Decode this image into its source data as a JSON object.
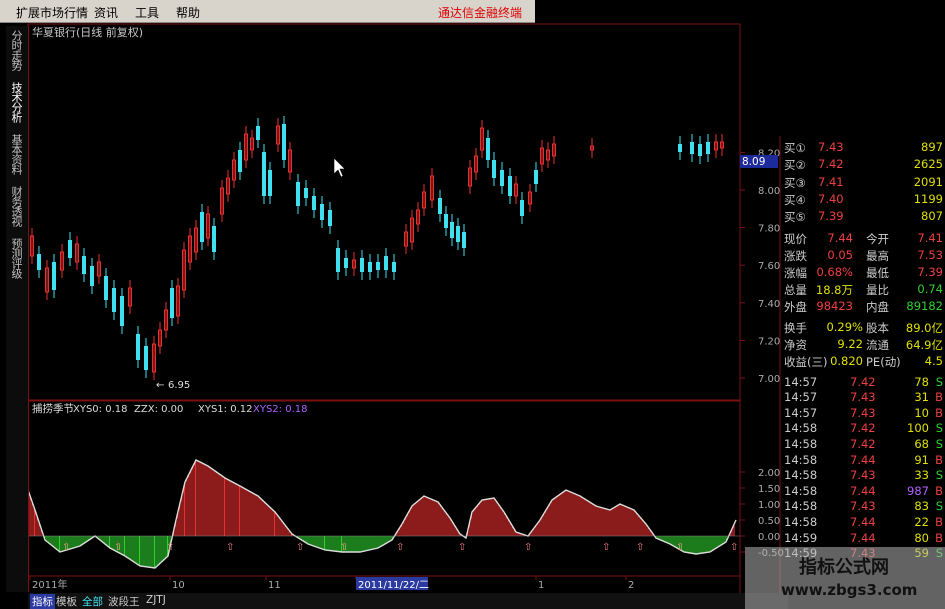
{
  "menu": {
    "items": [
      "扩展市场行情",
      "资讯",
      "工具",
      "帮助"
    ],
    "brand": "通达信金融终端"
  },
  "side_tabs": [
    "分时走势",
    "技术分析",
    "基本资料",
    "财务透视",
    "预测评级"
  ],
  "chart": {
    "title": "华夏银行(日线 前复权)",
    "price_ticks": [
      "8.20",
      "8.00",
      "7.80",
      "7.60",
      "7.40",
      "7.20",
      "7.00"
    ],
    "price_tag": "8.09",
    "low_label": "6.95",
    "indicator_name": "捕捞季节",
    "indicator_values": [
      {
        "name": "XYS0",
        "value": "0.18"
      },
      {
        "name": "ZZX",
        "value": "0.00"
      },
      {
        "name": "XYS1",
        "value": "0.12"
      },
      {
        "name": "XYS2",
        "value": "0.18"
      }
    ],
    "indicator_ticks": [
      "2.00",
      "1.50",
      "1.00",
      "0.50",
      "0.00",
      "-0.50"
    ],
    "date_labels": [
      "2011年",
      "10",
      "11",
      "2011/11/22/二",
      "1",
      "2"
    ],
    "bottom_tabs": [
      "指标",
      "模板",
      "全部",
      "波段王",
      "ZJTJ"
    ],
    "colors": {
      "up": "#e83030",
      "down": "#40e0f0",
      "grid": "#7a1010",
      "green": "#30d030",
      "purple": "#b060ff"
    }
  },
  "quote": {
    "bids": [
      {
        "label": "买①",
        "price": "7.43",
        "vol": "897"
      },
      {
        "label": "买②",
        "price": "7.42",
        "vol": "2625"
      },
      {
        "label": "买③",
        "price": "7.41",
        "vol": "2091"
      },
      {
        "label": "买④",
        "price": "7.40",
        "vol": "1199"
      },
      {
        "label": "买⑤",
        "price": "7.39",
        "vol": "807"
      }
    ],
    "stats": [
      {
        "l1": "现价",
        "v1": "7.44",
        "l2": "今开",
        "v2": "7.41"
      },
      {
        "l1": "涨跌",
        "v1": "0.05",
        "l2": "最高",
        "v2": "7.53"
      },
      {
        "l1": "涨幅",
        "v1": "0.68%",
        "l2": "最低",
        "v2": "7.39"
      },
      {
        "l1": "总量",
        "v1": "18.8万",
        "l2": "量比",
        "v2": "0.74"
      },
      {
        "l1": "外盘",
        "v1": "98423",
        "l2": "内盘",
        "v2": "89182"
      }
    ],
    "extra": [
      {
        "l1": "换手",
        "v1": "0.29%",
        "l2": "股本",
        "v2": "89.0亿"
      },
      {
        "l1": "净资",
        "v1": "9.22",
        "l2": "流通",
        "v2": "64.9亿"
      },
      {
        "l1": "收益(三)",
        "v1": "0.820",
        "l2": "PE(动)",
        "v2": "4.5"
      }
    ],
    "ticks": [
      {
        "time": "14:57",
        "price": "7.42",
        "vol": "78",
        "flag": "S"
      },
      {
        "time": "14:57",
        "price": "7.43",
        "vol": "31",
        "flag": "B"
      },
      {
        "time": "14:57",
        "price": "7.43",
        "vol": "10",
        "flag": "B"
      },
      {
        "time": "14:58",
        "price": "7.42",
        "vol": "100",
        "flag": "S"
      },
      {
        "time": "14:58",
        "price": "7.42",
        "vol": "68",
        "flag": "S"
      },
      {
        "time": "14:58",
        "price": "7.44",
        "vol": "91",
        "flag": "B"
      },
      {
        "time": "14:58",
        "price": "7.43",
        "vol": "33",
        "flag": "S"
      },
      {
        "time": "14:58",
        "price": "7.44",
        "vol": "987",
        "flag": "B"
      },
      {
        "time": "14:58",
        "price": "7.43",
        "vol": "83",
        "flag": "S"
      },
      {
        "time": "14:58",
        "price": "7.44",
        "vol": "22",
        "flag": "B"
      },
      {
        "time": "14:59",
        "price": "7.44",
        "vol": "80",
        "flag": "B"
      },
      {
        "time": "14:59",
        "price": "7.43",
        "vol": "59",
        "flag": "S"
      }
    ]
  },
  "watermark": {
    "title": "指标公式网",
    "url": "www.zbgs3.com"
  }
}
